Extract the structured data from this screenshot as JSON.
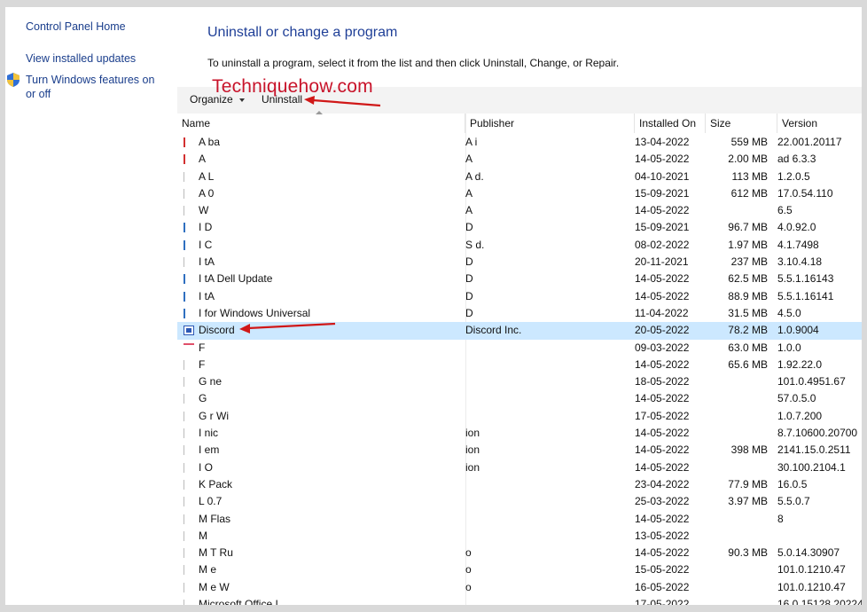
{
  "sidebar": {
    "home_link": "Control Panel Home",
    "updates_link": "View installed updates",
    "features_link": "Turn Windows features on or off"
  },
  "main": {
    "title": "Uninstall or change a program",
    "instructions": "To uninstall a program, select it from the list and then click Uninstall, Change, or Repair."
  },
  "watermark": "Techniquehow.com",
  "toolbar": {
    "organize_label": "Organize",
    "uninstall_label": "Uninstall"
  },
  "columns": {
    "name": "Name",
    "publisher": "Publisher",
    "installed_on": "Installed On",
    "size": "Size",
    "version": "Version"
  },
  "colors": {
    "link": "#1a3e8c",
    "title": "#1f3f97",
    "selected_row": "#cce8ff",
    "annotation_red": "#c8132a"
  },
  "programs": [
    {
      "icon": "adobe-icon",
      "name": "A               ba",
      "publisher": "A  i",
      "installed_on": "13-04-2022",
      "size": "559 MB",
      "version": "22.001.20117"
    },
    {
      "icon": "adobe-icon",
      "name": "A",
      "publisher": "A",
      "installed_on": "14-05-2022",
      "size": "2.00 MB",
      "version": "ad 6.3.3"
    },
    {
      "icon": "app-icon",
      "name": "A               L",
      "publisher": "A                                          d.",
      "installed_on": "04-10-2021",
      "size": "113 MB",
      "version": "1.2.0.5"
    },
    {
      "icon": "app-icon",
      "name": "A               0",
      "publisher": "A",
      "installed_on": "15-09-2021",
      "size": "612 MB",
      "version": "17.0.54.110"
    },
    {
      "icon": "app-icon",
      "name": "               W",
      "publisher": "A",
      "installed_on": "14-05-2022",
      "size": "",
      "version": "6.5"
    },
    {
      "icon": "blue-icon",
      "name": "I               D",
      "publisher": "D",
      "installed_on": "15-09-2021",
      "size": "96.7 MB",
      "version": "4.0.92.0"
    },
    {
      "icon": "blue-icon",
      "name": "I               C",
      "publisher": "S                                          d.",
      "installed_on": "08-02-2022",
      "size": "1.97 MB",
      "version": "4.1.7498"
    },
    {
      "icon": "app-icon",
      "name": "I               tA",
      "publisher": "D",
      "installed_on": "20-11-2021",
      "size": "237 MB",
      "version": "3.10.4.18"
    },
    {
      "icon": "blue-icon",
      "name": "I               tA                         Dell Update",
      "publisher": "D",
      "installed_on": "14-05-2022",
      "size": "62.5 MB",
      "version": "5.5.1.16143"
    },
    {
      "icon": "blue-icon",
      "name": "I               tA",
      "publisher": "D",
      "installed_on": "14-05-2022",
      "size": "88.9 MB",
      "version": "5.5.1.16141"
    },
    {
      "icon": "blue-icon",
      "name": "I               for Windows Universal",
      "publisher": "D",
      "installed_on": "11-04-2022",
      "size": "31.5 MB",
      "version": "4.5.0"
    },
    {
      "icon": "discord-icon",
      "name": "Discord",
      "publisher": "Discord Inc.",
      "installed_on": "20-05-2022",
      "size": "78.2 MB",
      "version": "1.0.9004",
      "selected": true
    },
    {
      "icon": "fb-icon",
      "name": "F",
      "publisher": "",
      "installed_on": "09-03-2022",
      "size": "63.0 MB",
      "version": "1.0.0"
    },
    {
      "icon": "plain-icon",
      "name": "F",
      "publisher": "",
      "installed_on": "14-05-2022",
      "size": "65.6 MB",
      "version": "1.92.22.0"
    },
    {
      "icon": "plain-icon",
      "name": "G               ne",
      "publisher": "",
      "installed_on": "18-05-2022",
      "size": "",
      "version": "101.0.4951.67"
    },
    {
      "icon": "plain-icon",
      "name": "G",
      "publisher": "",
      "installed_on": "14-05-2022",
      "size": "",
      "version": "57.0.5.0"
    },
    {
      "icon": "plain-icon",
      "name": "G               r Wi",
      "publisher": "",
      "installed_on": "17-05-2022",
      "size": "",
      "version": "1.0.7.200"
    },
    {
      "icon": "plain-icon",
      "name": "I               nic",
      "publisher": "                       ion",
      "installed_on": "14-05-2022",
      "size": "",
      "version": "8.7.10600.20700"
    },
    {
      "icon": "plain-icon",
      "name": "I               em",
      "publisher": "                       ion",
      "installed_on": "14-05-2022",
      "size": "398 MB",
      "version": "2141.15.0.2511"
    },
    {
      "icon": "plain-icon",
      "name": "I               O",
      "publisher": "                       ion",
      "installed_on": "14-05-2022",
      "size": "",
      "version": "30.100.2104.1"
    },
    {
      "icon": "plain-icon",
      "name": "K               Pack",
      "publisher": "",
      "installed_on": "23-04-2022",
      "size": "77.9 MB",
      "version": "16.0.5"
    },
    {
      "icon": "plain-icon",
      "name": "L               0.7",
      "publisher": "",
      "installed_on": "25-03-2022",
      "size": "3.97 MB",
      "version": "5.5.0.7"
    },
    {
      "icon": "plain-icon",
      "name": "M               Flas",
      "publisher": "",
      "installed_on": "14-05-2022",
      "size": "",
      "version": "8"
    },
    {
      "icon": "plain-icon",
      "name": "M",
      "publisher": "",
      "installed_on": "13-05-2022",
      "size": "",
      "version": ""
    },
    {
      "icon": "plain-icon",
      "name": "M               T Ru",
      "publisher": "                       o",
      "installed_on": "14-05-2022",
      "size": "90.3 MB",
      "version": "5.0.14.30907"
    },
    {
      "icon": "plain-icon",
      "name": "M               e",
      "publisher": "                       o",
      "installed_on": "15-05-2022",
      "size": "",
      "version": "101.0.1210.47"
    },
    {
      "icon": "plain-icon",
      "name": "M               e W",
      "publisher": "                       o",
      "installed_on": "16-05-2022",
      "size": "",
      "version": "101.0.1210.47"
    },
    {
      "icon": "plain-icon",
      "name": "Microsoft Office I",
      "publisher": "",
      "installed_on": "17-05-2022",
      "size": "",
      "version": "16.0.15128.20224"
    }
  ]
}
